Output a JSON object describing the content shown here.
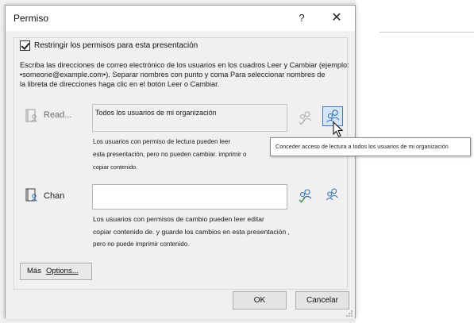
{
  "dialog": {
    "title": "Permiso",
    "help_label": "?",
    "close_label": "✕"
  },
  "restrict": {
    "checked": true,
    "label": "Restringir los permisos para esta presentación"
  },
  "instructions": {
    "line1": "Escriba las direcciones de correo electrónico de los usuarios en los cuadros Leer y Cambiar (ejemplo:",
    "line2": "•someone@example.com•). Separar nombres con punto y coma Para seleccionar nombres de",
    "line3": "la libreta de direcciones haga clic en el botón Leer o Cambiar."
  },
  "read": {
    "label": "Read...",
    "value": "Todos los usuarios de mi organización",
    "note_line1": "Los usuarios con permiso de lectura pueden leer",
    "note_line2": "esta presentación, pero no pueden cambiar. imprimir o",
    "note_line3": "copiar contenido.",
    "tooltip": "Conceder acceso de lectura a todos los usuarios de mi organización"
  },
  "change": {
    "label": "Chan",
    "value": "",
    "note_line1": "Los usuarios con permisos de cambio pueden leer editar",
    "note_line2": "copiar contenido de. y guarde los cambios en esta presentación ,",
    "note_line3": "pero no puede imprimir contenido."
  },
  "more_options": {
    "prefix": "Más",
    "label": "Options..."
  },
  "footer": {
    "ok_label": "OK",
    "cancel_label": "Cancelar"
  },
  "colors": {
    "accent": "#3b78c3",
    "icon_green": "#3a8f4a"
  }
}
